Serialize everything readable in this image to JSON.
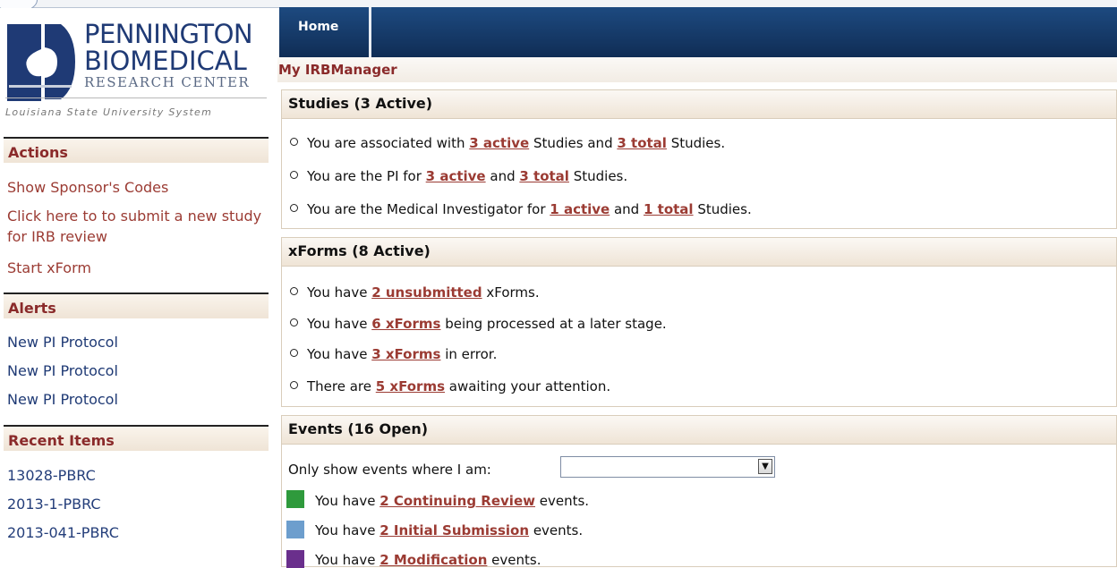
{
  "logo": {
    "line1": "PENNINGTON",
    "line2": "BIOMEDICAL",
    "line3": "RESEARCH CENTER",
    "system": "Louisiana State University System"
  },
  "sidebar": {
    "actions": {
      "title": "Actions",
      "items": [
        "Show Sponsor's Codes",
        "Click here to to submit a new study for IRB review",
        "Start xForm"
      ]
    },
    "alerts": {
      "title": "Alerts",
      "items": [
        "New PI Protocol",
        "New PI Protocol",
        "New PI Protocol"
      ]
    },
    "recent": {
      "title": "Recent Items",
      "items": [
        "13028-PBRC",
        "2013-1-PBRC",
        "2013-041-PBRC"
      ]
    }
  },
  "nav": {
    "home": "Home"
  },
  "breadcrumb": "My IRBManager",
  "studies": {
    "title": "Studies (3 Active)",
    "rows": [
      {
        "a": "You are associated with ",
        "l1": "3 active",
        "b": " Studies and ",
        "l2": "3 total",
        "c": " Studies."
      },
      {
        "a": "You are the PI for ",
        "l1": "3 active",
        "b": " and ",
        "l2": "3 total",
        "c": " Studies."
      },
      {
        "a": "You are the Medical Investigator for ",
        "l1": "1 active",
        "b": " and ",
        "l2": "1 total",
        "c": " Studies."
      }
    ]
  },
  "xforms": {
    "title": "xForms (8 Active)",
    "rows": [
      {
        "a": "You have ",
        "l1": "2 unsubmitted",
        "b": " xForms."
      },
      {
        "a": "You have ",
        "l1": "6 xForms",
        "b": " being processed at a later stage."
      },
      {
        "a": "You have ",
        "l1": "3 xForms",
        "b": " in error."
      },
      {
        "a": "There are ",
        "l1": "5 xForms",
        "b": " awaiting your attention."
      }
    ]
  },
  "events": {
    "title": "Events (16 Open)",
    "filter_label": "Only show events where I am:",
    "filter_value": "",
    "rows": [
      {
        "color": "#2f9a3c",
        "a": "You have ",
        "l1": "2 Continuing Review",
        "b": " events."
      },
      {
        "color": "#6d9ecd",
        "a": "You have ",
        "l1": "2 Initial Submission",
        "b": " events."
      },
      {
        "color": "#6a2f8c",
        "a": "You have ",
        "l1": "2 Modification",
        "b": " events."
      }
    ]
  }
}
